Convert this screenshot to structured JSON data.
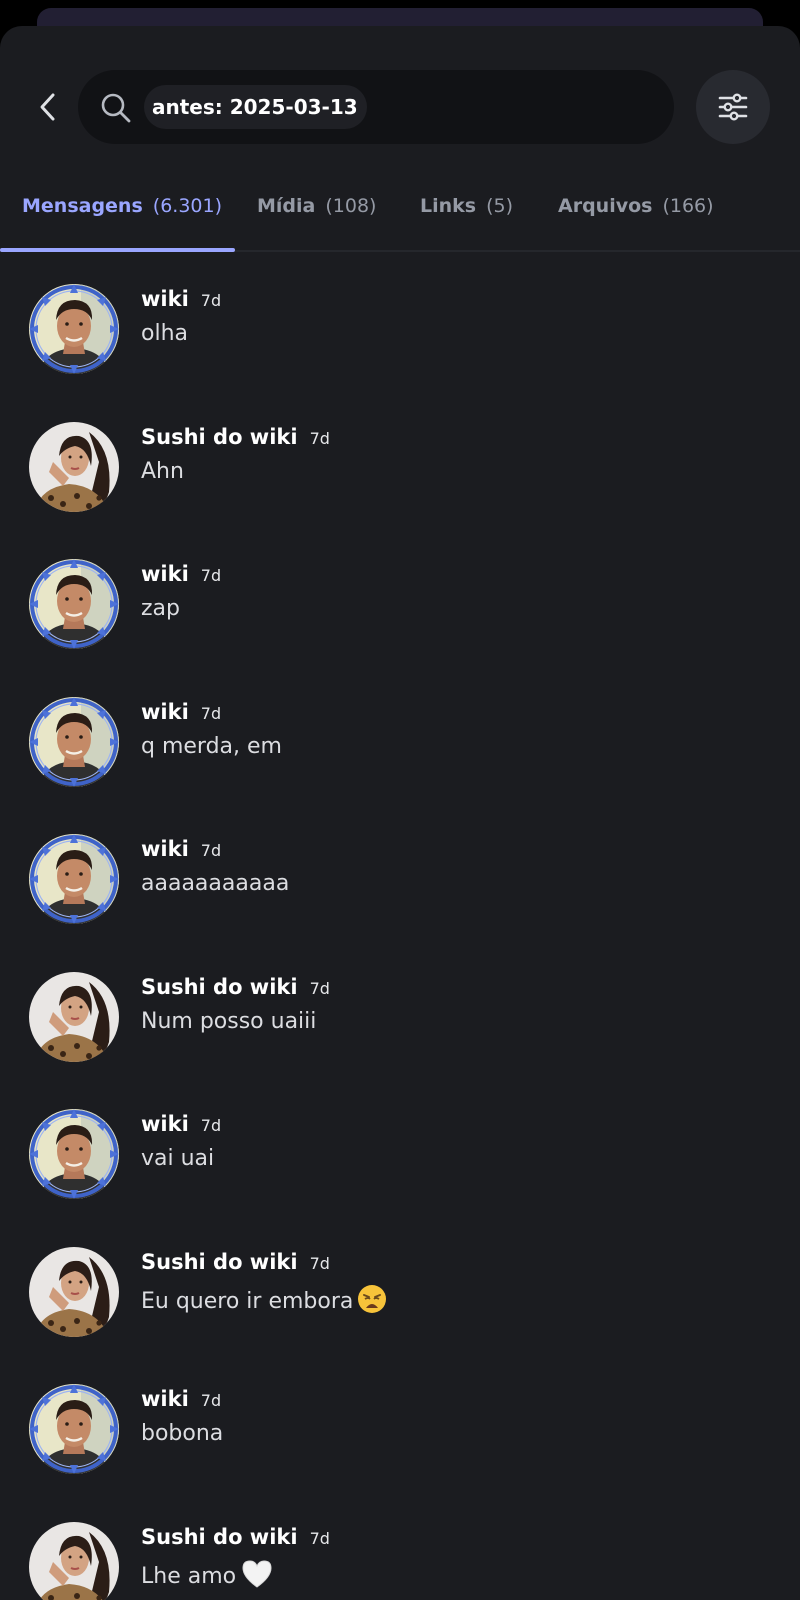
{
  "search": {
    "query": "antes: 2025-03-13"
  },
  "tabs": [
    {
      "label": "Mensagens",
      "count": "(6.301)",
      "active": true
    },
    {
      "label": "Mídia",
      "count": "(108)"
    },
    {
      "label": "Links",
      "count": "(5)"
    },
    {
      "label": "Arquivos",
      "count": "(166)"
    }
  ],
  "messages": [
    {
      "author": "wiki",
      "time": "7d",
      "text": "olha",
      "avatar": "man-portrait-with-blue-frame"
    },
    {
      "author": "Sushi do wiki",
      "time": "7d",
      "text": "Ahn",
      "avatar": "woman-portrait"
    },
    {
      "author": "wiki",
      "time": "7d",
      "text": "zap",
      "avatar": "man-portrait-with-blue-frame"
    },
    {
      "author": "wiki",
      "time": "7d",
      "text": "q merda, em",
      "avatar": "man-portrait-with-blue-frame"
    },
    {
      "author": "wiki",
      "time": "7d",
      "text": "aaaaaaaaaaa",
      "avatar": "man-portrait-with-blue-frame"
    },
    {
      "author": "Sushi do wiki",
      "time": "7d",
      "text": "Num posso uaiii",
      "avatar": "woman-portrait"
    },
    {
      "author": "wiki",
      "time": "7d",
      "text": "vai uai",
      "avatar": "man-portrait-with-blue-frame"
    },
    {
      "author": "Sushi do wiki",
      "time": "7d",
      "text": "Eu quero ir embora",
      "emoji": "weary-face-emoji",
      "avatar": "woman-portrait"
    },
    {
      "author": "wiki",
      "time": "7d",
      "text": "bobona",
      "avatar": "man-portrait-with-blue-frame"
    },
    {
      "author": "Sushi do wiki",
      "time": "7d",
      "text": "Lhe amo",
      "emoji": "white-heart-emoji",
      "avatar": "woman-portrait"
    }
  ],
  "colors": {
    "background": "#1b1c20",
    "search_box": "#111215",
    "accent": "#9aa6ff",
    "tab_inactive": "#959aa5"
  }
}
